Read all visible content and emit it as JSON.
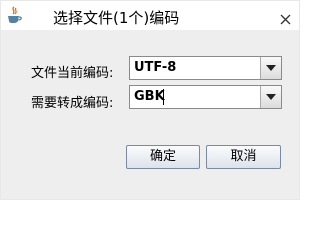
{
  "window": {
    "title": "选择文件(1个)编码"
  },
  "form": {
    "current_encoding_label": "文件当前编码:",
    "current_encoding_value": "UTF-8",
    "target_encoding_label": "需要转成编码:",
    "target_encoding_value": "GBK"
  },
  "buttons": {
    "ok_label": "确定",
    "cancel_label": "取消"
  },
  "icons": {
    "app": "java-coffee-icon",
    "close": "close-icon",
    "dropdown": "chevron-down-icon"
  }
}
